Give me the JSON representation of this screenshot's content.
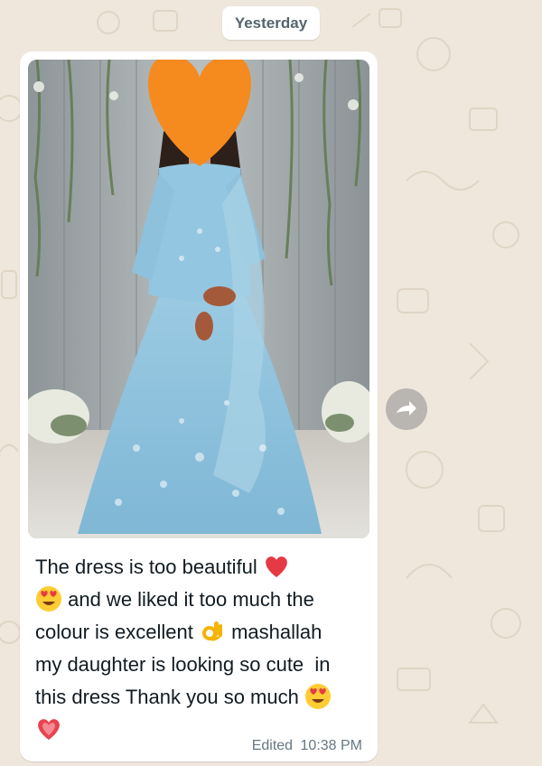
{
  "chat": {
    "date_separator": "Yesterday",
    "message": {
      "line1": "The dress is too beautiful ",
      "line2": " and we liked it too much the",
      "line3": "colour is excellent ",
      "line3b": " mashallah",
      "line4": "my daughter is looking so cute  in",
      "line5": "this dress Thank you so much ",
      "edited_label": "Edited",
      "time": "10:38 PM"
    },
    "icons": {
      "forward": "forward-icon",
      "heart": "red-heart-emoji",
      "heart_eyes": "heart-eyes-emoji",
      "ok_hand": "ok-hand-emoji",
      "sparkling_heart": "sparkling-heart-emoji",
      "face_cover": "orange-heart-emoji"
    }
  },
  "colors": {
    "wallpaper": "#efe7dc",
    "bubble": "#ffffff",
    "meta_text": "#667781",
    "dress": "#8fc4de"
  }
}
